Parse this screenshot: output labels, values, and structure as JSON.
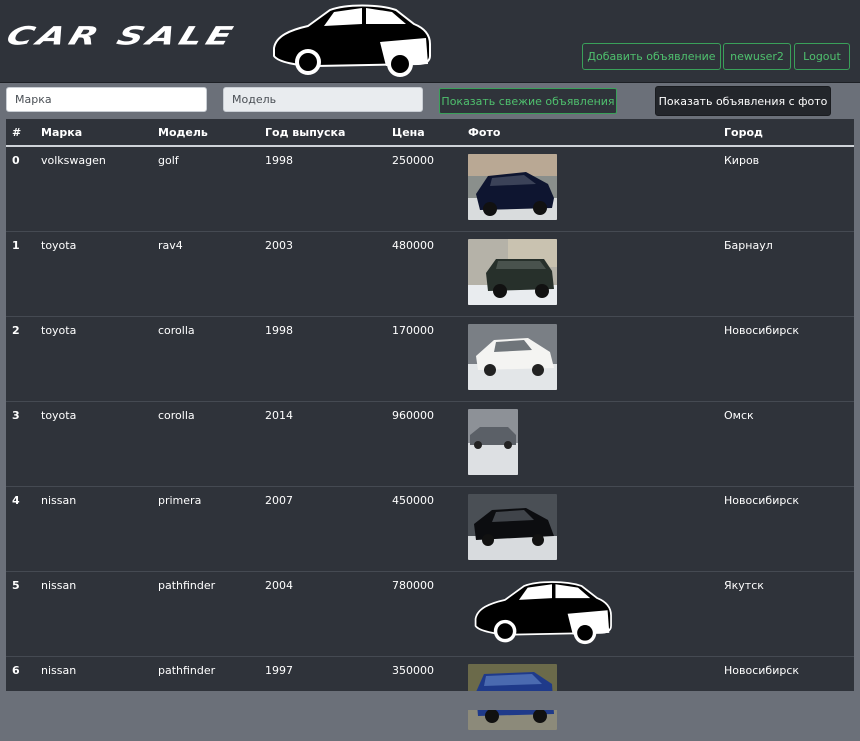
{
  "header": {
    "logo_text": "CAR SALE",
    "buttons": {
      "add_listing": "Добавить объявление",
      "user": "newuser2",
      "logout": "Logout"
    }
  },
  "filters": {
    "brand_placeholder": "Марка",
    "model_placeholder": "Модель",
    "fresh_button": "Показать свежие объявления",
    "photo_button": "Показать объявления с фото"
  },
  "table": {
    "columns": [
      "#",
      "Марка",
      "Модель",
      "Год выпуска",
      "Цена",
      "Фото",
      "Город"
    ],
    "rows": [
      {
        "num": "0",
        "brand": "volkswagen",
        "model": "golf",
        "year": "1998",
        "price": "250000",
        "photo": "dark-hatchback-photo",
        "city": "Киров"
      },
      {
        "num": "1",
        "brand": "toyota",
        "model": "rav4",
        "year": "2003",
        "price": "480000",
        "photo": "green-suv-photo",
        "city": "Барнаул"
      },
      {
        "num": "2",
        "brand": "toyota",
        "model": "corolla",
        "year": "1998",
        "price": "170000",
        "photo": "white-sedan-photo",
        "city": "Новосибирск"
      },
      {
        "num": "3",
        "brand": "toyota",
        "model": "corolla",
        "year": "2014",
        "price": "960000",
        "photo": "grey-sedan-photo",
        "city": "Омск"
      },
      {
        "num": "4",
        "brand": "nissan",
        "model": "primera",
        "year": "2007",
        "price": "450000",
        "photo": "black-sedan-photo",
        "city": "Новосибирск"
      },
      {
        "num": "5",
        "brand": "nissan",
        "model": "pathfinder",
        "year": "2004",
        "price": "780000",
        "photo": "placeholder-car-silhouette",
        "city": "Якутск"
      },
      {
        "num": "6",
        "brand": "nissan",
        "model": "pathfinder",
        "year": "1997",
        "price": "350000",
        "photo": "blue-suv-photo",
        "city": "Новосибирск"
      }
    ]
  },
  "colors": {
    "page_bg": "#6b7079",
    "panel_bg": "#2f333a",
    "accent_green": "#4fc06e"
  }
}
